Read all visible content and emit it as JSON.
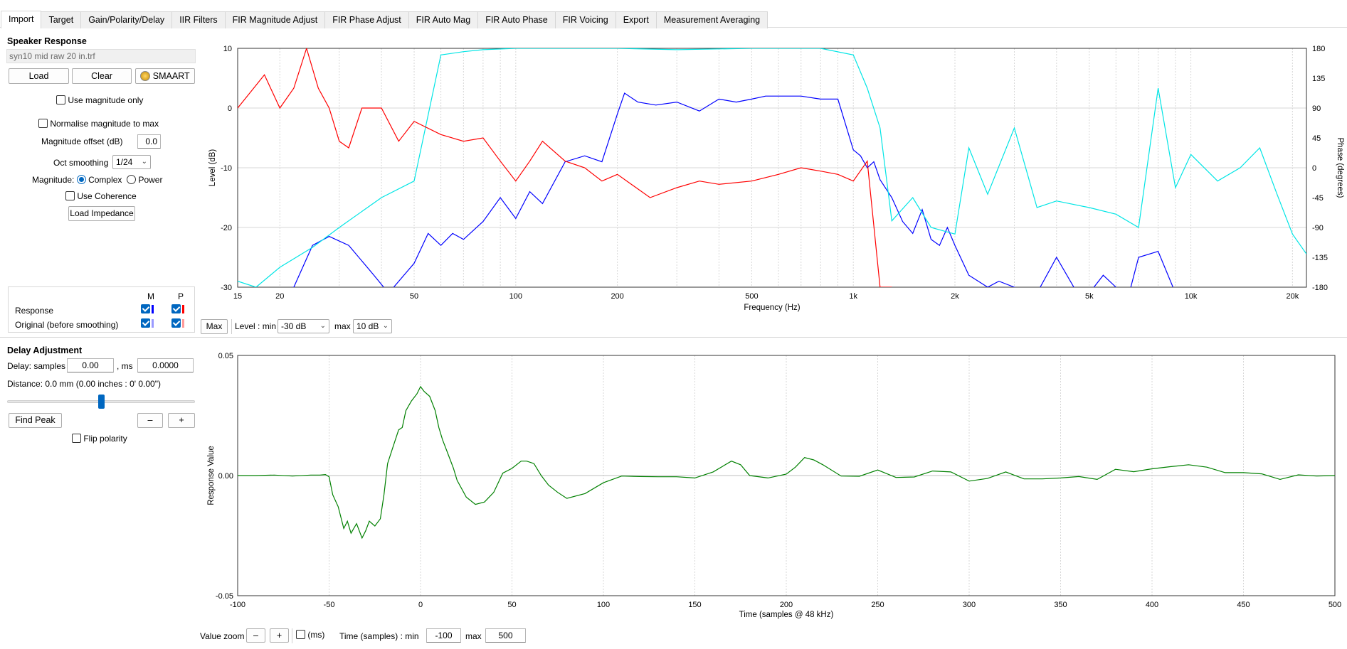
{
  "tabs": [
    "Import",
    "Target",
    "Gain/Polarity/Delay",
    "IIR Filters",
    "FIR Magnitude Adjust",
    "FIR Phase Adjust",
    "FIR Auto Mag",
    "FIR Auto Phase",
    "FIR Voicing",
    "Export",
    "Measurement Averaging"
  ],
  "active_tab": "Import",
  "speaker": {
    "heading": "Speaker Response",
    "filename": "syn10 mid raw 20 in.trf",
    "load_label": "Load",
    "clear_label": "Clear",
    "smaart_label": "SMAART",
    "use_mag_only": "Use magnitude only",
    "normalise": "Normalise magnitude to max",
    "mag_offset_label": "Magnitude offset (dB)",
    "mag_offset_value": "0.0",
    "oct_smoothing_label": "Oct smoothing",
    "oct_smoothing_value": "1/24",
    "magnitude_label": "Magnitude:",
    "complex_label": "Complex",
    "power_label": "Power",
    "use_coherence": "Use Coherence",
    "load_impedance": "Load Impedance"
  },
  "legend": {
    "col_m": "M",
    "col_p": "P",
    "rows": [
      {
        "label": "Response",
        "m_color": "#0000ff",
        "p_color": "#ff0000"
      },
      {
        "label": "Original (before smoothing)",
        "m_color": "#9a9aff",
        "p_color": "#ff9a9a"
      }
    ]
  },
  "freq_controls": {
    "max_label": "Max",
    "level_min_label": "Level : min",
    "level_min_value": "-30 dB",
    "max_text": "max",
    "level_max_value": "10 dB"
  },
  "delay": {
    "heading": "Delay Adjustment",
    "samples_label": "Delay: samples",
    "samples_value": "0.00",
    "ms_label": ", ms",
    "ms_value": "0.0000",
    "distance": "Distance: 0.0 mm (0.00 inches : 0'  0.00\")",
    "slider_level": 0.5,
    "find_peak": "Find Peak",
    "minus": "–",
    "plus": "+",
    "flip_polarity": "Flip polarity"
  },
  "ir_controls": {
    "value_zoom": "Value zoom",
    "minus": "–",
    "plus": "+",
    "ms": "(ms)",
    "time_label": "Time (samples) : min",
    "time_min": "-100",
    "max_text": "max",
    "time_max": "500"
  },
  "freq_chart": {
    "xlabel": "Frequency (Hz)",
    "ylabel": "Level (dB)",
    "y2label": "Phase (degrees)",
    "ylim": [
      -30,
      10
    ],
    "y2lim": [
      -180,
      180
    ],
    "xlim": [
      15,
      22000
    ],
    "y_ticks": [
      "10",
      "0",
      "-10",
      "-20",
      "-30"
    ],
    "y_tick_values": [
      10,
      0,
      -10,
      -20,
      -30
    ],
    "y2_ticks": [
      "180",
      "135",
      "90",
      "45",
      "0",
      "-45",
      "-90",
      "-135",
      "-180"
    ],
    "y2_tick_values": [
      180,
      135,
      90,
      45,
      0,
      -45,
      -90,
      -135,
      -180
    ],
    "x_ticks": [
      "15",
      "20",
      "50",
      "100",
      "200",
      "500",
      "1k",
      "2k",
      "5k",
      "10k",
      "20k"
    ],
    "x_tick_values": [
      15,
      20,
      50,
      100,
      200,
      500,
      1000,
      2000,
      5000,
      10000,
      20000
    ],
    "colors": {
      "magnitude": "#0000ff",
      "phase": "#ff0000",
      "coherence": "#00e5e5",
      "grid": "#d7d7d7"
    }
  },
  "chart_data": [
    {
      "type": "line",
      "title": "",
      "xlabel": "Frequency (Hz)",
      "ylabel": "Level (dB)",
      "xscale": "log",
      "xlim": [
        15,
        22000
      ],
      "ylim": [
        -30,
        10
      ],
      "grid": true,
      "series": [
        {
          "color": "#0000ff",
          "x": [
            15,
            18,
            22,
            25,
            28,
            32,
            38,
            42,
            50,
            55,
            60,
            65,
            70,
            80,
            90,
            100,
            110,
            120,
            140,
            160,
            180,
            200,
            210,
            230,
            260,
            300,
            350,
            400,
            450,
            500,
            550,
            600,
            700,
            800,
            900,
            1000,
            1050,
            1100,
            1150,
            1200,
            1300,
            1400,
            1500,
            1600,
            1700,
            1800,
            1900,
            2000,
            2200,
            2500,
            2700,
            3000,
            3500,
            4000,
            4500,
            5000,
            5500,
            6000,
            6500,
            7000,
            8000,
            9000,
            10000,
            11000,
            12000,
            14000,
            16000,
            18000,
            20000,
            22000
          ],
          "y": [
            -31,
            -31,
            -30,
            -23,
            -21.5,
            -23,
            -28,
            -31,
            -26,
            -21,
            -23,
            -21,
            -22,
            -19,
            -15,
            -18.5,
            -14,
            -16,
            -9,
            -8,
            -9,
            -1,
            2.5,
            1,
            0.5,
            1,
            -0.5,
            1.5,
            1,
            1.5,
            2,
            2,
            2,
            1.5,
            1.5,
            -7,
            -8,
            -10,
            -9,
            -12,
            -15,
            -19,
            -21,
            -17,
            -22,
            -23,
            -20,
            -23,
            -28,
            -30,
            -29,
            -30,
            -31,
            -25,
            -30,
            -31,
            -28,
            -30,
            -32,
            -25,
            -24,
            -31,
            -33,
            -32,
            -31,
            -32,
            -33,
            -32,
            -31,
            -31
          ]
        },
        {
          "color": "#00e5e5",
          "axis": "phase",
          "x": [
            15,
            17,
            20,
            25,
            30,
            40,
            50,
            60,
            70,
            80,
            100,
            150,
            200,
            300,
            500,
            800,
            1000,
            1100,
            1200,
            1300,
            1500,
            1700,
            2000,
            2200,
            2500,
            3000,
            3500,
            4000,
            5000,
            6000,
            7000,
            8000,
            9000,
            10000,
            12000,
            14000,
            16000,
            18000,
            20000,
            22000
          ],
          "y": [
            -171,
            -180,
            -150,
            -120,
            -90,
            -45,
            -20,
            170,
            175,
            178,
            180,
            180,
            180,
            178,
            180,
            180,
            170,
            120,
            60,
            -80,
            -45,
            -90,
            -100,
            30,
            -40,
            60,
            -60,
            -50,
            -60,
            -70,
            -90,
            120,
            -30,
            20,
            -20,
            0,
            30,
            -40,
            -100,
            -130
          ]
        },
        {
          "color": "#ff0000",
          "axis": "phase",
          "x": [
            15,
            18,
            20,
            22,
            24,
            26,
            28,
            30,
            32,
            35,
            40,
            45,
            50,
            60,
            70,
            80,
            90,
            100,
            110,
            120,
            140,
            160,
            180,
            200,
            250,
            300,
            350,
            400,
            500,
            600,
            700,
            800,
            900,
            1000,
            1100,
            1200,
            1300
          ],
          "y": [
            90,
            140,
            90,
            120,
            180,
            120,
            90,
            40,
            30,
            90,
            90,
            40,
            70,
            50,
            40,
            45,
            10,
            -20,
            10,
            40,
            10,
            0,
            -20,
            -10,
            -45,
            -30,
            -20,
            -25,
            -20,
            -10,
            0,
            -5,
            -10,
            -20,
            10,
            -180,
            -180
          ]
        }
      ]
    },
    {
      "type": "line",
      "title": "",
      "xlabel": "Time (samples @ 48 kHz)",
      "ylabel": "Response Value",
      "xlim": [
        -100,
        500
      ],
      "ylim": [
        -0.05,
        0.05
      ],
      "grid": true,
      "series": [
        {
          "color": "#008000",
          "x": [
            -100,
            -90,
            -80,
            -70,
            -60,
            -55,
            -52,
            -50,
            -48,
            -45,
            -42,
            -40,
            -38,
            -35,
            -32,
            -30,
            -28,
            -25,
            -22,
            -20,
            -18,
            -15,
            -12,
            -10,
            -8,
            -5,
            -2,
            0,
            2,
            5,
            8,
            10,
            12,
            15,
            18,
            20,
            25,
            30,
            35,
            40,
            45,
            50,
            55,
            58,
            62,
            66,
            70,
            75,
            80,
            90,
            100,
            110,
            120,
            130,
            140,
            150,
            160,
            170,
            175,
            180,
            190,
            200,
            205,
            210,
            215,
            220,
            230,
            240,
            250,
            260,
            270,
            280,
            290,
            300,
            310,
            320,
            330,
            340,
            350,
            360,
            370,
            380,
            390,
            400,
            410,
            420,
            430,
            440,
            450,
            460,
            470,
            480,
            490,
            500
          ],
          "y": [
            0,
            0,
            0.0002,
            -0.0002,
            0.0002,
            0.0002,
            0.0004,
            -0.0005,
            -0.008,
            -0.013,
            -0.022,
            -0.019,
            -0.024,
            -0.02,
            -0.026,
            -0.023,
            -0.019,
            -0.021,
            -0.018,
            -0.008,
            0.005,
            0.012,
            0.019,
            0.02,
            0.027,
            0.031,
            0.034,
            0.037,
            0.035,
            0.033,
            0.027,
            0.02,
            0.015,
            0.009,
            0.003,
            -0.002,
            -0.009,
            -0.012,
            -0.011,
            -0.007,
            0.001,
            0.003,
            0.006,
            0.006,
            0.005,
            0,
            -0.004,
            -0.007,
            -0.0095,
            -0.0075,
            -0.003,
            -0.0002,
            -0.0004,
            -0.0005,
            -0.0005,
            -0.001,
            0.0015,
            0.006,
            0.0045,
            0,
            -0.001,
            0.0006,
            0.0035,
            0.0075,
            0.0065,
            0.0045,
            -0.0002,
            -0.0003,
            0.0023,
            -0.0008,
            -0.0006,
            0.0019,
            0.0015,
            -0.0023,
            -0.0012,
            0.0015,
            -0.0014,
            -0.0014,
            -0.001,
            -0.0004,
            -0.0016,
            0.0026,
            0.0016,
            0.0028,
            0.0037,
            0.0045,
            0.0035,
            0.0012,
            0.0012,
            0.0007,
            -0.0016,
            0.0003,
            -0.0002,
            0
          ]
        }
      ]
    }
  ],
  "ir_chart": {
    "xlabel": "Time (samples @ 48 kHz)",
    "ylabel": "Response Value",
    "xlim": [
      -100,
      500
    ],
    "ylim": [
      -0.05,
      0.05
    ],
    "y_ticks": [
      "0.05",
      "0.00",
      "-0.05"
    ],
    "y_tick_values": [
      0.05,
      0,
      -0.05
    ],
    "x_ticks": [
      "-100",
      "-50",
      "0",
      "50",
      "100",
      "150",
      "200",
      "250",
      "300",
      "350",
      "400",
      "450",
      "500"
    ],
    "x_tick_values": [
      -100,
      -50,
      0,
      50,
      100,
      150,
      200,
      250,
      300,
      350,
      400,
      450,
      500
    ],
    "colors": {
      "line": "#008000",
      "grid": "#d7d7d7",
      "zero": "#bfbfbf"
    }
  }
}
